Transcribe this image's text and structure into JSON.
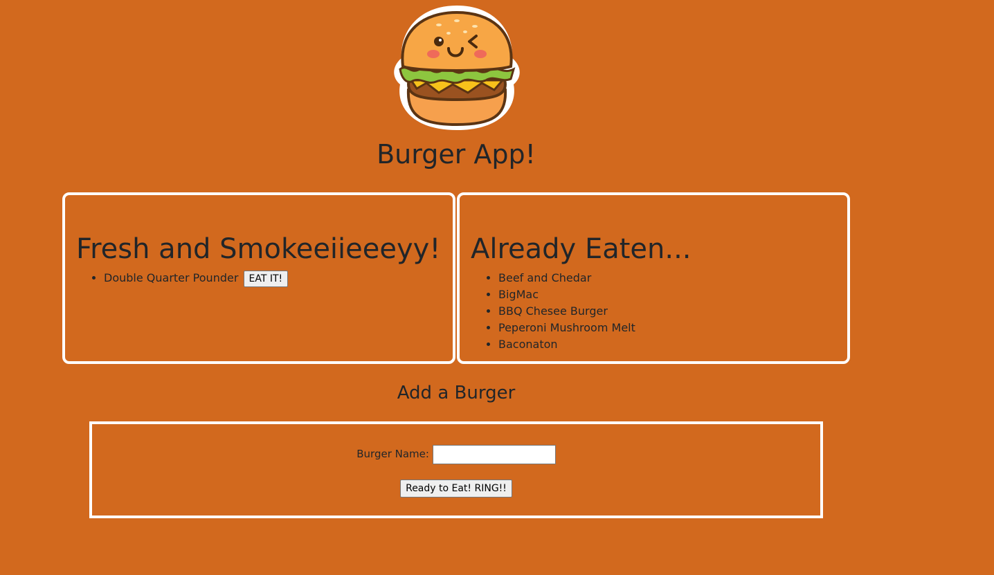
{
  "header": {
    "logo_icon": "burger-mascot-icon",
    "title": "Burger App!"
  },
  "fresh": {
    "heading": "Fresh and Smokeeiieeeyy!",
    "items": [
      {
        "name": "Double Quarter Pounder",
        "button_label": "EAT IT!"
      }
    ]
  },
  "eaten": {
    "heading": "Already Eaten...",
    "items": [
      "Beef and Chedar",
      "BigMac",
      "BBQ Chesee Burger",
      "Peperoni Mushroom Melt",
      "Baconaton"
    ]
  },
  "add_form": {
    "heading": "Add a Burger",
    "name_label": "Burger Name:",
    "name_value": "",
    "submit_label": "Ready to Eat! RING!!"
  },
  "colors": {
    "background": "#D2691E",
    "border": "#FFFFFF",
    "text": "#212529"
  }
}
